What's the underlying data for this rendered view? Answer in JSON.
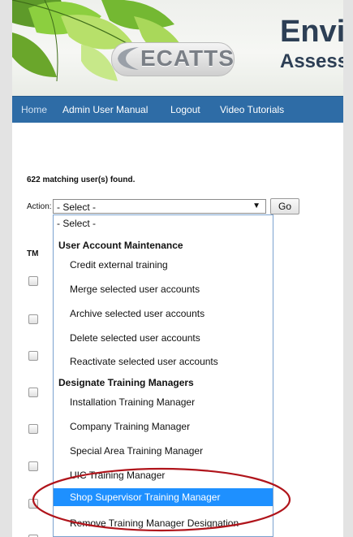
{
  "header": {
    "logo_text": "ECATTS",
    "title_partial": "Envi",
    "subtitle_partial": "Assessm"
  },
  "nav": {
    "items": [
      "Home",
      "Admin User Manual",
      "Logout",
      "Video Tutorials"
    ]
  },
  "results": {
    "count_text": "622 matching user(s) found."
  },
  "action": {
    "label": "Action:",
    "selected": "- Select -",
    "arrow": "▼",
    "go_label": "Go"
  },
  "table": {
    "tm_header": "TM"
  },
  "dropdown": {
    "top_option": "- Select -",
    "group1": {
      "label": "User Account Maintenance",
      "items": [
        "Credit external training",
        "Merge selected user accounts",
        "Archive selected user accounts",
        "Delete selected user accounts",
        "Reactivate selected user accounts"
      ]
    },
    "group2": {
      "label": "Designate Training Managers",
      "items": [
        "Installation Training Manager",
        "Company Training Manager",
        "Special Area Training Manager",
        "UIC Training Manager",
        "Shop Supervisor Training Manager",
        "Remove Training Manager Designation"
      ]
    },
    "selected_index_group2": 4
  },
  "colors": {
    "nav_bg": "#2e6ca6",
    "selection": "#1e90ff",
    "annotation_ring": "#b0141b"
  }
}
